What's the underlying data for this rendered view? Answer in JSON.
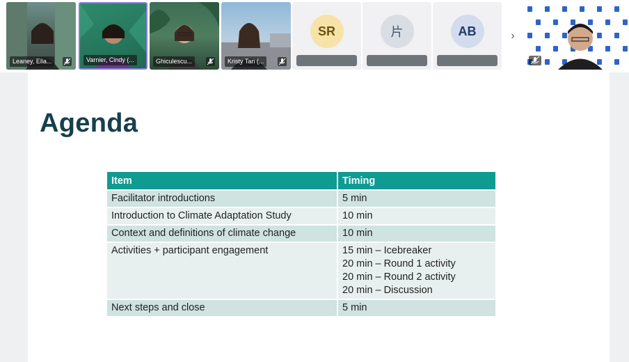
{
  "participants": [
    {
      "name": "Leaney, Ella...",
      "type": "video"
    },
    {
      "name": "Varnier, Cindy (...",
      "type": "video",
      "active": true
    },
    {
      "name": "Ghiculescu...",
      "type": "video"
    },
    {
      "name": "Kristy Tan (...",
      "type": "video"
    },
    {
      "initials": "SR",
      "type": "avatar"
    },
    {
      "initials": "片",
      "type": "avatar"
    },
    {
      "initials": "AB",
      "type": "avatar"
    }
  ],
  "next_label": "›",
  "slide": {
    "title": "Agenda",
    "table": {
      "headers": [
        "Item",
        "Timing"
      ],
      "rows": [
        {
          "item": "Facilitator introductions",
          "timing": [
            "5 min"
          ]
        },
        {
          "item": "Introduction to Climate Adaptation Study",
          "timing": [
            "10 min"
          ]
        },
        {
          "item": "Context and definitions of climate change",
          "timing": [
            "10 min"
          ]
        },
        {
          "item": "Activities + participant engagement",
          "timing": [
            "15 min – Icebreaker",
            "20 min – Round 1 activity",
            "20 min – Round 2 activity",
            "20 min – Discussion"
          ]
        },
        {
          "item": "Next steps and close",
          "timing": [
            "5 min"
          ]
        }
      ]
    }
  }
}
